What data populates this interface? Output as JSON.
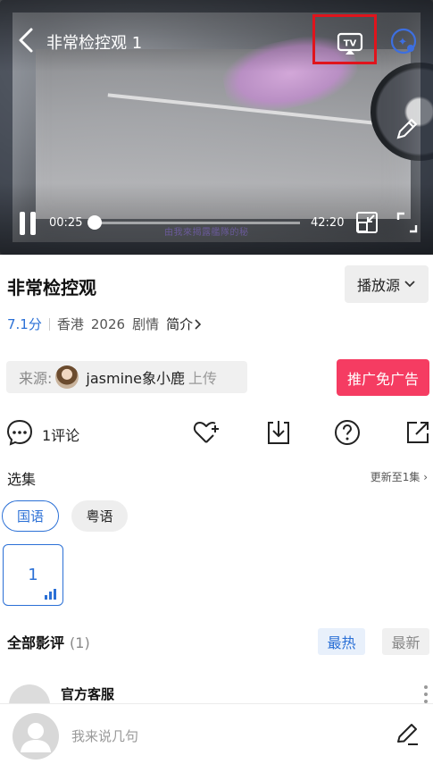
{
  "player": {
    "title": "非常检控观 1",
    "current_time": "00:25",
    "total_time": "42:20",
    "progress_fraction": 0.01,
    "subtitle_text": "由我來揭露艦隊的秘",
    "icons": [
      "back-icon",
      "tv-cast-icon",
      "speed-icon",
      "edit-icon",
      "pause-icon",
      "pip-icon",
      "fullscreen-icon"
    ]
  },
  "show": {
    "title": "非常检控观",
    "source_label": "播放源",
    "rating": "7.1分",
    "region": "香港",
    "year": "2026",
    "genre": "剧情",
    "intro_label": "简介"
  },
  "uploader": {
    "label": "来源:",
    "name": "jasmine象小鹿",
    "suffix": "上传",
    "ad_button": "推广免广告"
  },
  "actions": {
    "comment_count": "1评论"
  },
  "episodes": {
    "label": "选集",
    "update_text": "更新至1集",
    "languages": [
      "国语",
      "粤语"
    ],
    "items": [
      "1"
    ]
  },
  "reviews": {
    "title": "全部影评",
    "count": "(1)",
    "sort_hot": "最热",
    "sort_new": "最新",
    "first_author": "官方客服"
  },
  "composer": {
    "placeholder": "我来说几句"
  },
  "colors": {
    "accent_blue": "#2b70d6",
    "ad_pink": "#f53c62",
    "highlight_red": "#e0141c"
  }
}
